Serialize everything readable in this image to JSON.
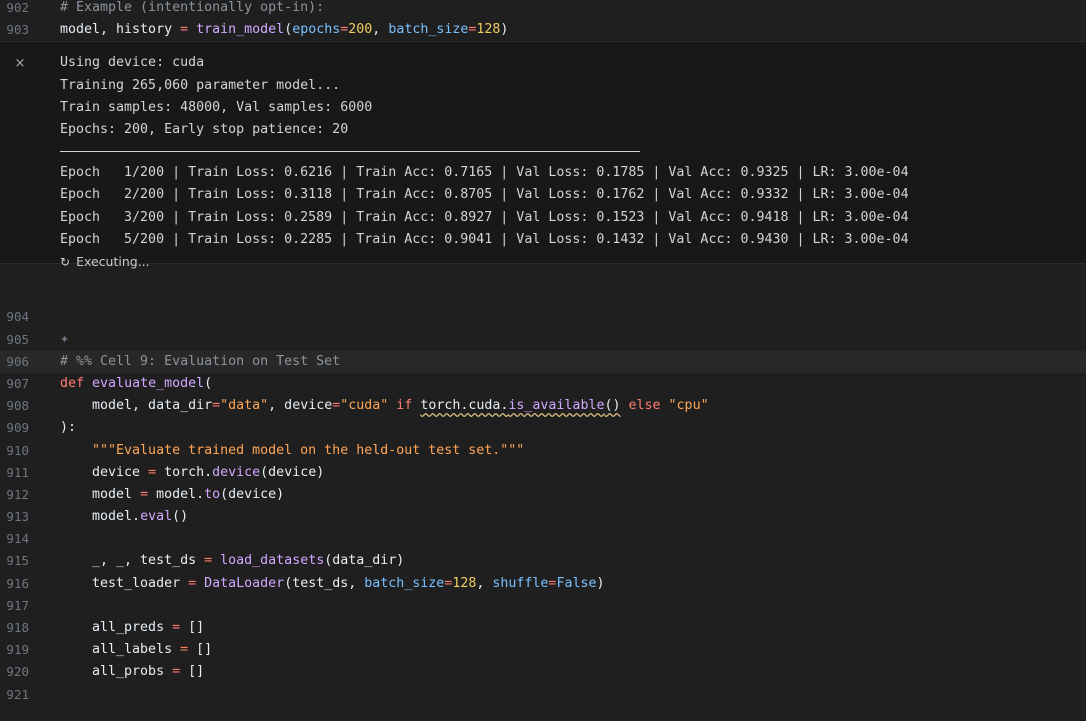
{
  "cell_top": {
    "lines": [
      {
        "num": "902",
        "tokens": [
          {
            "t": "# Example (intentionally opt-in):",
            "c": "k-comment"
          }
        ]
      },
      {
        "num": "903",
        "tokens": [
          {
            "t": "model, history ",
            "c": "k-plain"
          },
          {
            "t": "=",
            "c": "k-op"
          },
          {
            "t": " ",
            "c": "k-plain"
          },
          {
            "t": "train_model",
            "c": "k-fn"
          },
          {
            "t": "(",
            "c": "k-plain"
          },
          {
            "t": "epochs",
            "c": "k-param"
          },
          {
            "t": "=",
            "c": "k-op"
          },
          {
            "t": "200",
            "c": "k-num"
          },
          {
            "t": ", ",
            "c": "k-plain"
          },
          {
            "t": "batch_size",
            "c": "k-param"
          },
          {
            "t": "=",
            "c": "k-op"
          },
          {
            "t": "128",
            "c": "k-num"
          },
          {
            "t": ")",
            "c": "k-plain"
          }
        ]
      }
    ]
  },
  "output": {
    "close_label": "×",
    "header_lines": [
      "Using device: cuda",
      "Training 265,060 parameter model...",
      "Train samples: 48000, Val samples: 6000",
      "Epochs: 200, Early stop patience: 20"
    ],
    "epoch_lines": [
      "Epoch   1/200 | Train Loss: 0.6216 | Train Acc: 0.7165 | Val Loss: 0.1785 | Val Acc: 0.9325 | LR: 3.00e-04",
      "Epoch   2/200 | Train Loss: 0.3118 | Train Acc: 0.8705 | Val Loss: 0.1762 | Val Acc: 0.9332 | LR: 3.00e-04",
      "Epoch   3/200 | Train Loss: 0.2589 | Train Acc: 0.8927 | Val Loss: 0.1523 | Val Acc: 0.9418 | LR: 3.00e-04",
      "Epoch   5/200 | Train Loss: 0.2285 | Train Acc: 0.9041 | Val Loss: 0.1432 | Val Acc: 0.9430 | LR: 3.00e-04"
    ],
    "status_icon": "↻",
    "status": "Executing..."
  },
  "cell_bottom": {
    "lines": [
      {
        "num": "904",
        "tokens": []
      },
      {
        "num": "905",
        "tokens": [
          {
            "t": "✦",
            "c": "spark"
          }
        ]
      },
      {
        "num": "906",
        "highlight": true,
        "tokens": [
          {
            "t": "# %% Cell 9: Evaluation on Test Set",
            "c": "k-comment"
          }
        ]
      },
      {
        "num": "907",
        "tokens": [
          {
            "t": "def",
            "c": "k-kw"
          },
          {
            "t": " ",
            "c": "k-plain"
          },
          {
            "t": "evaluate_model",
            "c": "k-fn"
          },
          {
            "t": "(",
            "c": "k-plain"
          }
        ]
      },
      {
        "num": "908",
        "tokens": [
          {
            "t": "    model, data_dir",
            "c": "k-plain"
          },
          {
            "t": "=",
            "c": "k-op"
          },
          {
            "t": "\"data\"",
            "c": "k-str"
          },
          {
            "t": ", device",
            "c": "k-plain"
          },
          {
            "t": "=",
            "c": "k-op"
          },
          {
            "t": "\"cuda\"",
            "c": "k-str"
          },
          {
            "t": " ",
            "c": "k-plain"
          },
          {
            "t": "if",
            "c": "k-kw"
          },
          {
            "t": " ",
            "c": "k-plain"
          },
          {
            "t": "torch.cuda.",
            "c": "k-plain k-squig"
          },
          {
            "t": "is_available",
            "c": "k-fn-squig"
          },
          {
            "t": "()",
            "c": "k-plain k-squig"
          },
          {
            "t": " ",
            "c": "k-plain"
          },
          {
            "t": "else",
            "c": "k-kw"
          },
          {
            "t": " ",
            "c": "k-plain"
          },
          {
            "t": "\"cpu\"",
            "c": "k-str"
          }
        ]
      },
      {
        "num": "909",
        "tokens": [
          {
            "t": "):",
            "c": "k-plain"
          }
        ]
      },
      {
        "num": "910",
        "tokens": [
          {
            "t": "    \"\"\"Evaluate trained model on the held-out test set.\"\"\"",
            "c": "k-str"
          }
        ]
      },
      {
        "num": "911",
        "tokens": [
          {
            "t": "    device ",
            "c": "k-plain"
          },
          {
            "t": "=",
            "c": "k-op"
          },
          {
            "t": " torch.",
            "c": "k-plain"
          },
          {
            "t": "device",
            "c": "k-fn"
          },
          {
            "t": "(device)",
            "c": "k-plain"
          }
        ]
      },
      {
        "num": "912",
        "tokens": [
          {
            "t": "    model ",
            "c": "k-plain"
          },
          {
            "t": "=",
            "c": "k-op"
          },
          {
            "t": " model.",
            "c": "k-plain"
          },
          {
            "t": "to",
            "c": "k-fn"
          },
          {
            "t": "(device)",
            "c": "k-plain"
          }
        ]
      },
      {
        "num": "913",
        "tokens": [
          {
            "t": "    model.",
            "c": "k-plain"
          },
          {
            "t": "eval",
            "c": "k-fn"
          },
          {
            "t": "()",
            "c": "k-plain"
          }
        ]
      },
      {
        "num": "914",
        "tokens": []
      },
      {
        "num": "915",
        "tokens": [
          {
            "t": "    _, _, test_ds ",
            "c": "k-plain"
          },
          {
            "t": "=",
            "c": "k-op"
          },
          {
            "t": " ",
            "c": "k-plain"
          },
          {
            "t": "load_datasets",
            "c": "k-fn"
          },
          {
            "t": "(data_dir)",
            "c": "k-plain"
          }
        ]
      },
      {
        "num": "916",
        "tokens": [
          {
            "t": "    test_loader ",
            "c": "k-plain"
          },
          {
            "t": "=",
            "c": "k-op"
          },
          {
            "t": " ",
            "c": "k-plain"
          },
          {
            "t": "DataLoader",
            "c": "k-fn"
          },
          {
            "t": "(test_ds, ",
            "c": "k-plain"
          },
          {
            "t": "batch_size",
            "c": "k-param"
          },
          {
            "t": "=",
            "c": "k-op"
          },
          {
            "t": "128",
            "c": "k-num"
          },
          {
            "t": ", ",
            "c": "k-plain"
          },
          {
            "t": "shuffle",
            "c": "k-param"
          },
          {
            "t": "=",
            "c": "k-op"
          },
          {
            "t": "False",
            "c": "k-param"
          },
          {
            "t": ")",
            "c": "k-plain"
          }
        ]
      },
      {
        "num": "917",
        "tokens": []
      },
      {
        "num": "918",
        "tokens": [
          {
            "t": "    all_preds ",
            "c": "k-plain"
          },
          {
            "t": "=",
            "c": "k-op"
          },
          {
            "t": " []",
            "c": "k-plain"
          }
        ]
      },
      {
        "num": "919",
        "tokens": [
          {
            "t": "    all_labels ",
            "c": "k-plain"
          },
          {
            "t": "=",
            "c": "k-op"
          },
          {
            "t": " []",
            "c": "k-plain"
          }
        ]
      },
      {
        "num": "920",
        "tokens": [
          {
            "t": "    all_probs ",
            "c": "k-plain"
          },
          {
            "t": "=",
            "c": "k-op"
          },
          {
            "t": " []",
            "c": "k-plain"
          }
        ]
      },
      {
        "num": "921",
        "tokens": []
      }
    ]
  }
}
